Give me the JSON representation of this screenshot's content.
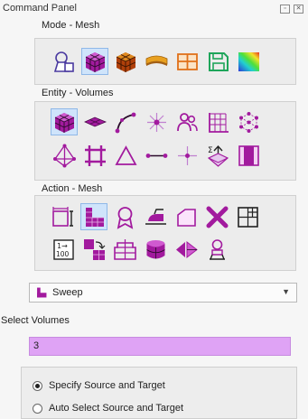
{
  "panel": {
    "title": "Command Panel"
  },
  "mode": {
    "label": "Mode - Mesh",
    "icons": [
      "geometry-shapes-icon",
      "mesh-cube-icon",
      "orange-cube-mesh-icon",
      "boundary-strip-icon",
      "blocks-icon",
      "save-disk-icon",
      "colormap-gradient-icon"
    ],
    "selected": 1
  },
  "entity": {
    "label": "Entity - Volumes",
    "icons": [
      "volume-cube-icon",
      "surface-plane-icon",
      "curve-icon",
      "vertex-star-icon",
      "group-people-icon",
      "grid-icon",
      "node-dots-icon",
      "tetra-icon",
      "hash-block-icon",
      "triangle-icon",
      "edge-line-icon",
      "node-cross-icon",
      "summation-arrow-icon",
      "split-panel-icon"
    ],
    "selected": 0
  },
  "action": {
    "label": "Action - Mesh",
    "icons": [
      "interval-icon",
      "sweep-mesh-icon",
      "ribbon-badge-icon",
      "smooth-iron-icon",
      "refine-shape-icon",
      "delete-x-icon",
      "quad-grid-icon",
      "scale-100-icon",
      "copy-mesh-icon",
      "pagoda-mesh-icon",
      "cylinder-mesh-icon",
      "diamond-flip-icon",
      "person-node-icon"
    ],
    "selected": 1
  },
  "scheme": {
    "selected": "Sweep",
    "icon": "sweep-mesh-icon"
  },
  "select_volumes": {
    "label": "Select Volumes",
    "value": "3"
  },
  "options": [
    {
      "label": "Specify Source and Target",
      "checked": true
    },
    {
      "label": "Auto Select Source and Target",
      "checked": false
    }
  ],
  "colors": {
    "magenta": "#a21a9e",
    "purple_input": "#dfa3f5",
    "selection": "#cfe4fb"
  }
}
